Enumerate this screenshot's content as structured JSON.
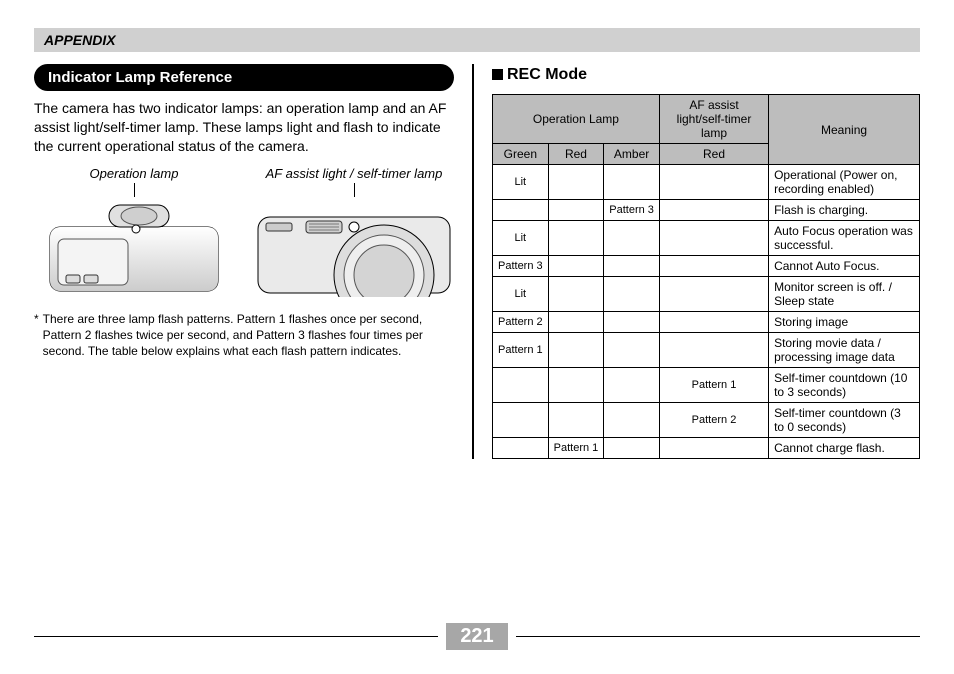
{
  "section": "APPENDIX",
  "left": {
    "title": "Indicator Lamp Reference",
    "intro": "The camera has two indicator lamps: an operation lamp and an AF assist light/self-timer lamp. These lamps light and flash to indicate the current operational status of the camera.",
    "diagram": {
      "left_caption": "Operation lamp",
      "right_caption": "AF assist light / self-timer lamp"
    },
    "footnote": "There are three lamp flash patterns. Pattern 1 flashes once per second, Pattern 2 flashes twice per second, and Pattern 3 flashes four times per second. The table below explains what each flash pattern indicates."
  },
  "right": {
    "heading": "REC Mode",
    "headers": {
      "operation": "Operation Lamp",
      "af": "AF assist light/self-timer lamp",
      "meaning": "Meaning",
      "green": "Green",
      "red": "Red",
      "amber": "Amber",
      "af_red": "Red"
    },
    "rows": [
      {
        "green": "Lit",
        "red": "",
        "amber": "",
        "af": "",
        "meaning": "Operational (Power on, recording enabled)"
      },
      {
        "green": "",
        "red": "",
        "amber": "Pattern 3",
        "af": "",
        "meaning": "Flash is charging."
      },
      {
        "green": "Lit",
        "red": "",
        "amber": "",
        "af": "",
        "meaning": "Auto Focus operation was successful."
      },
      {
        "green": "Pattern 3",
        "red": "",
        "amber": "",
        "af": "",
        "meaning": "Cannot Auto Focus."
      },
      {
        "green": "Lit",
        "red": "",
        "amber": "",
        "af": "",
        "meaning": "Monitor screen is off. / Sleep state"
      },
      {
        "green": "Pattern 2",
        "red": "",
        "amber": "",
        "af": "",
        "meaning": "Storing image"
      },
      {
        "green": "Pattern 1",
        "red": "",
        "amber": "",
        "af": "",
        "meaning": "Storing movie data / processing image data"
      },
      {
        "green": "",
        "red": "",
        "amber": "",
        "af": "Pattern 1",
        "meaning": "Self-timer countdown (10 to 3 seconds)"
      },
      {
        "green": "",
        "red": "",
        "amber": "",
        "af": "Pattern 2",
        "meaning": "Self-timer countdown (3 to 0 seconds)"
      },
      {
        "green": "",
        "red": "Pattern 1",
        "amber": "",
        "af": "",
        "meaning": "Cannot charge flash."
      }
    ]
  },
  "page": "221"
}
